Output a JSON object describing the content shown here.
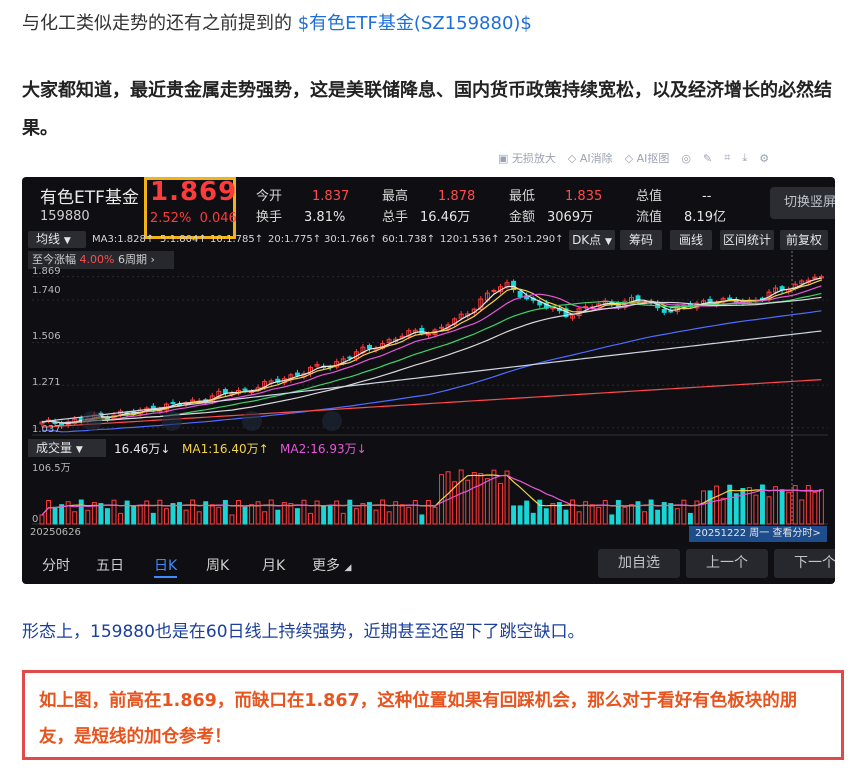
{
  "article": {
    "p1_text": "与化工类似走势的还有之前提到的 ",
    "p1_link": "$有色ETF基金(SZ159880)$",
    "p2": "大家都知道，最近贵金属走势强势，这是美联储降息、国内货币政策持续宽松，以及经济增长的必然结果。",
    "p3": "形态上，159880也是在60日线上持续强势，近期甚至还留下了跳空缺口。",
    "callout": "如上图，前高在1.869，而缺口在1.867，这种位置如果有回踩机会，那么对于看好有色板块的朋友，是短线的加仓参考！"
  },
  "image_toolbar": {
    "items": [
      "无损放大",
      "AI消除",
      "AI抠图"
    ],
    "icons": [
      "target-icon",
      "edit-icon",
      "crop-icon",
      "download-icon",
      "settings-icon"
    ]
  },
  "quote": {
    "name": "有色ETF基金",
    "code": "159880",
    "price": "1.869",
    "change_pct": "2.52%",
    "change": "0.046",
    "fields": {
      "open_label": "今开",
      "open": "1.837",
      "high_label": "最高",
      "high": "1.878",
      "low_label": "最低",
      "low": "1.835",
      "cap_label": "总值",
      "cap": "--",
      "turnover_label": "换手",
      "turnover": "3.81%",
      "vol_label": "总手",
      "vol": "16.46万",
      "amount_label": "金额",
      "amount": "3069万",
      "float_label": "流值",
      "float": "8.19亿"
    },
    "switch_label": "切换竖屏"
  },
  "ma_bar": {
    "select": "均线",
    "items": [
      {
        "text": "MA3:1.828↑",
        "color": "#e8e8e8"
      },
      {
        "text": "5:1.804↑",
        "color": "#f2d34a"
      },
      {
        "text": "10:1.785↑",
        "color": "#e657d8"
      },
      {
        "text": "20:1.775↑",
        "color": "#3fd26a"
      },
      {
        "text": "30:1.766↑",
        "color": "#d9d9d9"
      },
      {
        "text": "60:1.738↑",
        "color": "#4f6cff"
      },
      {
        "text": "120:1.536↑",
        "color": "#cfd6e6"
      },
      {
        "text": "250:1.290↑",
        "color": "#ff4b4b"
      }
    ],
    "buttons": [
      "DK点",
      "筹码",
      "画线",
      "区间统计",
      "前复权"
    ]
  },
  "tip": {
    "label": "至今涨幅",
    "pct": "4.00%",
    "period": "6周期"
  },
  "price_axis": [
    "1.869",
    "1.740",
    "1.506",
    "1.271",
    "1.037"
  ],
  "volume": {
    "select": "成交量",
    "vol": "16.46万↓",
    "ma1": "MA1:16.40万↑",
    "ma2": "MA2:16.93万↓",
    "axis_top": "106.5万",
    "axis_bottom": "0"
  },
  "dates": {
    "start": "20250626",
    "cursor": "20251222 周一 查看分时>"
  },
  "period_tabs": [
    "分时",
    "五日",
    "日K",
    "周K",
    "月K",
    "更多"
  ],
  "active_tab": "日K",
  "bottom_buttons": [
    "加自选",
    "上一个",
    "下一个"
  ],
  "colors": {
    "up": "#ff3b3b",
    "down": "#19d6d6",
    "link": "#1e6fd9",
    "accent": "#3d8bff",
    "highlight_box": "#f2b316"
  },
  "chart_data": {
    "type": "candlestick",
    "x_range": [
      "20250626",
      "20251222"
    ],
    "y_ticks": [
      1.037,
      1.271,
      1.506,
      1.74,
      1.869
    ],
    "ylim": [
      1.03,
      1.9
    ],
    "close_path": [
      1.06,
      1.065,
      1.07,
      1.08,
      1.09,
      1.1,
      1.12,
      1.11,
      1.13,
      1.15,
      1.16,
      1.17,
      1.18,
      1.2,
      1.22,
      1.23,
      1.24,
      1.26,
      1.28,
      1.3,
      1.33,
      1.35,
      1.37,
      1.38,
      1.42,
      1.45,
      1.47,
      1.5,
      1.53,
      1.55,
      1.57,
      1.56,
      1.6,
      1.63,
      1.68,
      1.75,
      1.8,
      1.82,
      1.78,
      1.73,
      1.7,
      1.68,
      1.66,
      1.69,
      1.71,
      1.73,
      1.72,
      1.74,
      1.73,
      1.7,
      1.68,
      1.7,
      1.72,
      1.74,
      1.73,
      1.74,
      1.73,
      1.75,
      1.78,
      1.8,
      1.83,
      1.86,
      1.869
    ],
    "volume_peak": 106.5
  }
}
